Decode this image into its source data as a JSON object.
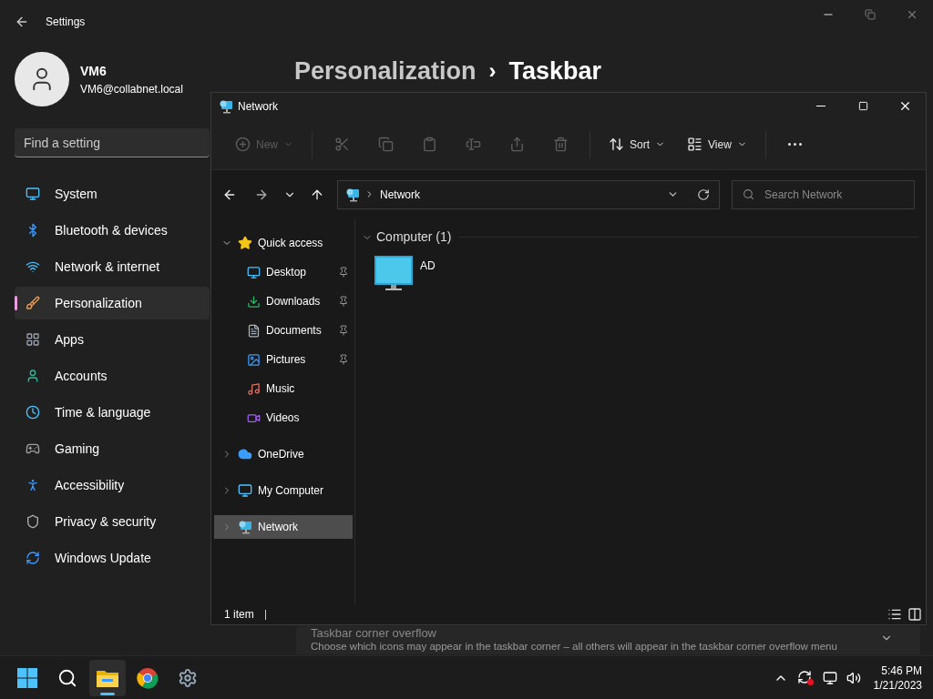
{
  "settings": {
    "title": "Settings",
    "user": {
      "name": "VM6",
      "email": "VM6@collabnet.local"
    },
    "search": {
      "placeholder": "Find a setting"
    },
    "nav": [
      {
        "label": "System",
        "selected": false
      },
      {
        "label": "Bluetooth & devices",
        "selected": false
      },
      {
        "label": "Network & internet",
        "selected": false
      },
      {
        "label": "Personalization",
        "selected": true
      },
      {
        "label": "Apps",
        "selected": false
      },
      {
        "label": "Accounts",
        "selected": false
      },
      {
        "label": "Time & language",
        "selected": false
      },
      {
        "label": "Gaming",
        "selected": false
      },
      {
        "label": "Accessibility",
        "selected": false
      },
      {
        "label": "Privacy & security",
        "selected": false
      },
      {
        "label": "Windows Update",
        "selected": false
      }
    ],
    "breadcrumb": {
      "parent": "Personalization",
      "separator": "›",
      "current": "Taskbar"
    },
    "card": {
      "title": "Taskbar corner overflow",
      "description": "Choose which icons may appear in the taskbar corner – all others will appear in the taskbar corner overflow menu"
    }
  },
  "explorer": {
    "title": "Network",
    "toolbar": [
      {
        "kind": "dropdown",
        "label": "New",
        "disabled": true
      },
      {
        "kind": "icon",
        "disabled": true
      },
      {
        "kind": "icon",
        "disabled": true
      },
      {
        "kind": "icon",
        "disabled": true
      },
      {
        "kind": "icon",
        "disabled": true
      },
      {
        "kind": "icon",
        "disabled": true
      },
      {
        "kind": "icon",
        "disabled": true
      },
      {
        "kind": "dropdown",
        "label": "Sort",
        "disabled": false
      },
      {
        "kind": "dropdown",
        "label": "View",
        "disabled": false
      },
      {
        "kind": "icon",
        "disabled": false
      }
    ],
    "address": {
      "path": "Network"
    },
    "search": {
      "placeholder": "Search Network"
    },
    "tree": [
      {
        "label": "Quick access",
        "expanded": true,
        "selected": false,
        "children": [
          {
            "label": "Desktop",
            "pinned": true,
            "selected": false
          },
          {
            "label": "Downloads",
            "pinned": true,
            "selected": false
          },
          {
            "label": "Documents",
            "pinned": true,
            "selected": false
          },
          {
            "label": "Pictures",
            "pinned": true,
            "selected": false
          },
          {
            "label": "Music",
            "pinned": false,
            "selected": false
          },
          {
            "label": "Videos",
            "pinned": false,
            "selected": false
          }
        ]
      },
      {
        "label": "OneDrive",
        "expanded": false,
        "selected": false
      },
      {
        "label": "My Computer",
        "expanded": false,
        "selected": false
      },
      {
        "label": "Network",
        "expanded": false,
        "selected": true
      }
    ],
    "group": {
      "title": "Computer (1)",
      "expanded": true
    },
    "items": [
      {
        "label": "AD"
      }
    ],
    "status": "1 item"
  },
  "taskbar": {
    "apps": [
      {
        "active": false
      },
      {
        "active": false
      },
      {
        "active": true
      },
      {
        "active": false
      },
      {
        "active": false
      }
    ],
    "clock": {
      "time": "5:46 PM",
      "date": "1/21/2023"
    }
  }
}
